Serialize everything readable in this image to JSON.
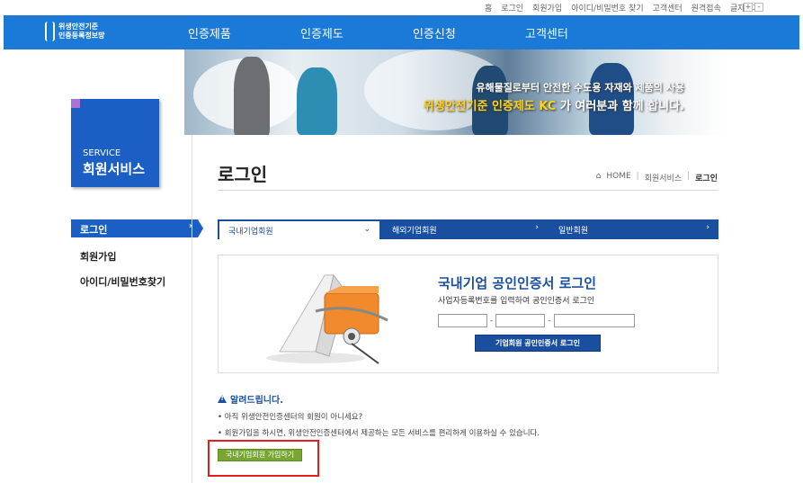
{
  "util_links": [
    "홈",
    "로그인",
    "회원가입",
    "아이디/비밀번호 찾기",
    "고객센터",
    "원격접속",
    "글자크기"
  ],
  "font_size_controls": [
    "+",
    "-"
  ],
  "logo": {
    "line1": "위생안전기준",
    "line2": "인증등록정보망"
  },
  "gnb": [
    "인증제품",
    "인증제도",
    "인증신청",
    "고객센터"
  ],
  "banner": {
    "line1": "유해물질로부터 안전한 수도용 자재와 제품의 사용",
    "line2_highlight": "위생안전기준 인증제도 KC",
    "line2_rest": "가 여러분과 함께 합니다."
  },
  "sidebar": {
    "title_en": "SERVICE",
    "title_ko": "회원서비스",
    "items": [
      "로그인",
      "회원가입",
      "아이디/비밀번호찾기"
    ]
  },
  "page": {
    "title": "로그인",
    "breadcrumb": [
      "HOME",
      "회원서비스",
      "로그인"
    ]
  },
  "tabs": [
    "국내기업회원",
    "해외기업회원",
    "일반회원"
  ],
  "login": {
    "title": "국내기업 공인인증서 로그인",
    "subtitle": "사업자등록번호를 입력하여 공인인증서 로그인",
    "button": "기업회원 공인인증서 로그인",
    "biz_no_1": "",
    "biz_no_2": "",
    "biz_no_3": ""
  },
  "notice": {
    "title": "알려드립니다.",
    "line1": "• 아직 위생안전인증센터의 회원이 아니세요?",
    "line2": "• 회원가입을 하시면, 위생안전인증센터에서 제공하는 모든 서비스를 편리하게 이용하실 수 있습니다.",
    "join_button": "국내기업회원 가입하기"
  },
  "colors": {
    "nav_blue": "#1b7ad8",
    "brand_dark": "#1a4fa0",
    "join_green": "#78a632",
    "highlight_red": "#e31e1e"
  }
}
